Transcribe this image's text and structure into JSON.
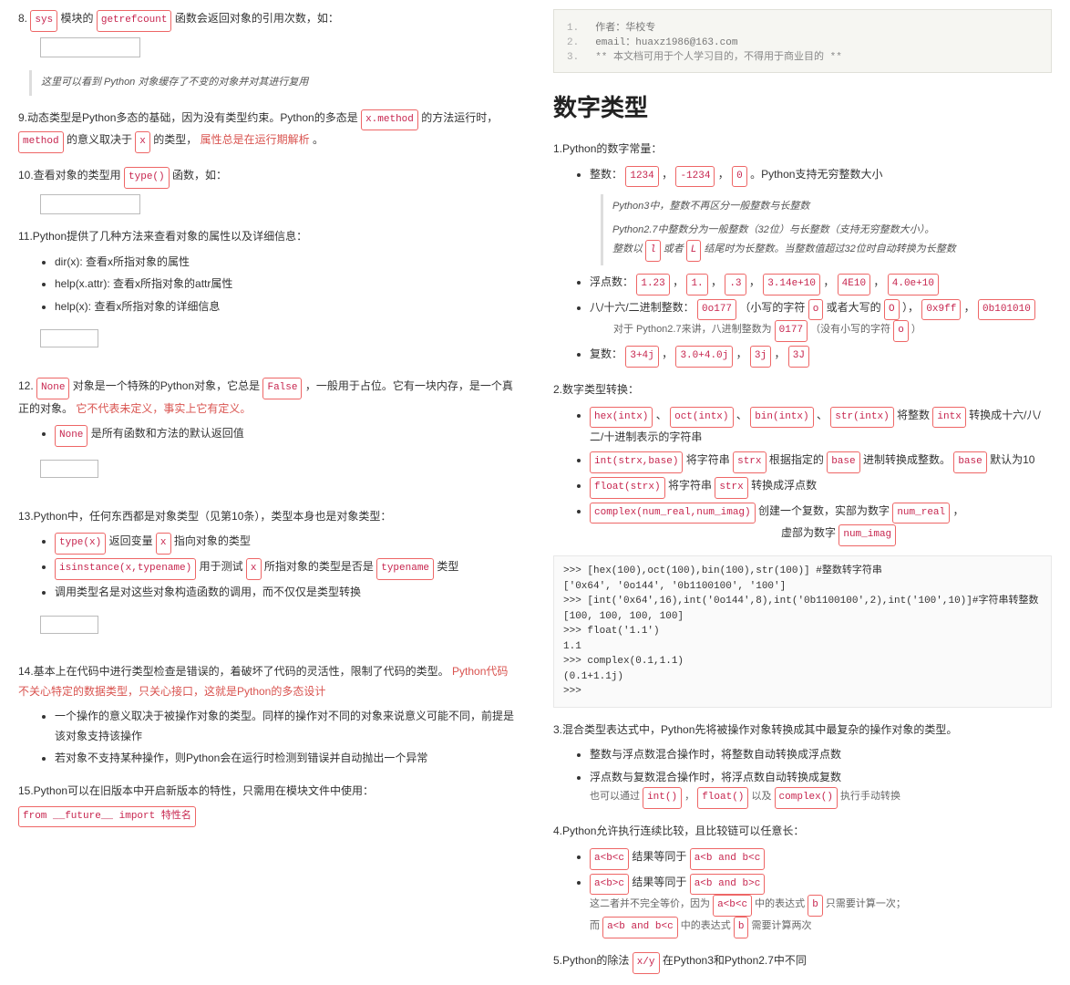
{
  "left": {
    "p8_a": "8.",
    "p8_sys": "sys",
    "p8_b": " 模块的 ",
    "p8_grc": "getrefcount",
    "p8_c": " 函数会返回对象的引用次数，如：",
    "p8_bq": "这里可以看到 Python 对象缓存了不变的对象并对其进行复用",
    "p9_a": "9.动态类型是Python多态的基础，因为没有类型约束。Python的多态是 ",
    "p9_xm": "x.method",
    "p9_b": " 的方法运行时，",
    "p9_m": "method",
    "p9_c": " 的意义取决于 ",
    "p9_x": "x",
    "p9_d": " 的类型，",
    "p9_red": "属性总是在运行期解析",
    "p9_e": "。",
    "p10_a": "10.查看对象的类型用 ",
    "p10_t": "type()",
    "p10_b": " 函数，如：",
    "p11_a": "11.Python提供了几种方法来查看对象的属性以及详细信息：",
    "p11_li1": "dir(x): 查看x所指对象的属性",
    "p11_li2": "help(x.attr): 查看x所指对象的attr属性",
    "p11_li3": "help(x): 查看x所指对象的详细信息",
    "p12_a": "12. ",
    "p12_none": "None",
    "p12_b": " 对象是一个特殊的Python对象，它总是 ",
    "p12_false": "False",
    "p12_c": " ，一般用于占位。它有一块内存，是一个真正的对象。",
    "p12_red": "它不代表未定义，事实上它有定义。",
    "p12_li_a": "",
    "p12_li_none": "None",
    "p12_li_b": " 是所有函数和方法的默认返回值",
    "p13_a": "13.Python中，任何东西都是对象类型（见第10条），类型本身也是对象类型：",
    "p13_li1_a": "",
    "p13_li1_t": "type(x)",
    "p13_li1_b": " 返回变量 ",
    "p13_li1_x": "x",
    "p13_li1_c": " 指向对象的类型",
    "p13_li2_a": "",
    "p13_li2_is": "isinstance(x,typename)",
    "p13_li2_b": " 用于测试 ",
    "p13_li2_x": "x",
    "p13_li2_c": " 所指对象的类型是否是 ",
    "p13_li2_tn": "typename",
    "p13_li2_d": " 类型",
    "p13_li3": "调用类型名是对这些对象构造函数的调用，而不仅仅是类型转换",
    "p14_a": "14.基本上在代码中进行类型检查是错误的，着破坏了代码的灵活性，限制了代码的类型。",
    "p14_red": "Python代码不关心特定的数据类型，只关心接口，这就是Python的多态设计",
    "p14_li1": "一个操作的意义取决于被操作对象的类型。同样的操作对不同的对象来说意义可能不同，前提是该对象支持该操作",
    "p14_li2": "若对象不支持某种操作，则Python会在运行时检测到错误并自动抛出一个异常",
    "p15_a": "15.Python可以在旧版本中开启新版本的特性，只需用在模块文件中使用：",
    "p15_code": "from __future__ import 特性名"
  },
  "right": {
    "hdr_l1": "作者：华校专",
    "hdr_l2": "email：huaxz1986@163.com",
    "hdr_l3": "**  本文档可用于个人学习目的，不得用于商业目的  **",
    "title": "数字类型",
    "s1": "1.Python的数字常量：",
    "s1_int_a": "整数：",
    "s1_int_c1": "1234",
    "s1_int_c2": "-1234",
    "s1_int_c3": "0",
    "s1_int_b": "。Python支持无穷整数大小",
    "s1_int_bq1": "Python3中，整数不再区分一般整数与长整数",
    "s1_int_bq2_a": "Python2.7中整数分为一般整数（32位）与长整数（支持无穷整数大小）。",
    "s1_int_bq2_b": "整数以 ",
    "s1_int_bq2_l": "l",
    "s1_int_bq2_c": " 或者 ",
    "s1_int_bq2_L": "L",
    "s1_int_bq2_d": " 结尾时为长整数。当整数值超过32位时自动转换为长整数",
    "s1_fl_a": "浮点数：",
    "s1_fl_c1": "1.23",
    "s1_fl_c2": "1.",
    "s1_fl_c3": ".3",
    "s1_fl_c4": "3.14e+10",
    "s1_fl_c5": "4E10",
    "s1_fl_c6": "4.0e+10",
    "s1_hex_a": "八/十六/二进制整数：",
    "s1_hex_c1": "0o177",
    "s1_hex_b": "（小写的字符 ",
    "s1_hex_o": "o",
    "s1_hex_c": " 或者大写的 ",
    "s1_hex_O": "O",
    "s1_hex_d": " ），",
    "s1_hex_c2": "0x9ff",
    "s1_hex_c3": "0b101010",
    "s1_hex_sub_a": "对于 Python2.7来讲，八进制整数为 ",
    "s1_hex_sub_c": "0177",
    "s1_hex_sub_b": " （没有小写的字符 ",
    "s1_hex_sub_o": "o",
    "s1_hex_sub_d": " ）",
    "s1_cx_a": "复数：",
    "s1_cx_c1": "3+4j",
    "s1_cx_c2": "3.0+4.0j",
    "s1_cx_c3": "3j",
    "s1_cx_c4": "3J",
    "s2": "2.数字类型转换：",
    "s2_li1_c1": "hex(intx)",
    "s2_li1_c2": "oct(intx)",
    "s2_li1_c3": "bin(intx)",
    "s2_li1_c4": "str(intx)",
    "s2_li1_a": "将整数 ",
    "s2_li1_ix": "intx",
    "s2_li1_b": " 转换成十六/八/二/十进制表示的字符串",
    "s2_li2_c1": "int(strx,base)",
    "s2_li2_a": " 将字符串 ",
    "s2_li2_sx": "strx",
    "s2_li2_b": " 根据指定的 ",
    "s2_li2_bs": "base",
    "s2_li2_c": " 进制转换成整数。",
    "s2_li2_bs2": "base",
    "s2_li2_d": " 默认为10",
    "s2_li3_c1": "float(strx)",
    "s2_li3_a": " 将字符串 ",
    "s2_li3_sx": "strx",
    "s2_li3_b": " 转换成浮点数",
    "s2_li4_c1": "complex(num_real,num_imag)",
    "s2_li4_a": " 创建一个复数，实部为数字 ",
    "s2_li4_nr": "num_real",
    "s2_li4_b": " ，",
    "s2_li4_cont_a": "虚部为数字 ",
    "s2_li4_ni": "num_imag",
    "pre": ">>> [hex(100),oct(100),bin(100),str(100)] #整数转字符串\n['0x64', '0o144', '0b1100100', '100']\n>>> [int('0x64',16),int('0o144',8),int('0b1100100',2),int('100',10)]#字符串转整数\n[100, 100, 100, 100]\n>>> float('1.1')\n1.1\n>>> complex(0.1,1.1)\n(0.1+1.1j)\n>>> ",
    "s3": "3.混合类型表达式中，Python先将被操作对象转换成其中最复杂的操作对象的类型。",
    "s3_li1": "整数与浮点数混合操作时，将整数自动转换成浮点数",
    "s3_li2": "浮点数与复数混合操作时，将浮点数自动转换成复数",
    "s3_sub_a": "也可以通过 ",
    "s3_sub_c1": "int()",
    "s3_sub_c2": "float()",
    "s3_sub_b": " 以及 ",
    "s3_sub_c3": "complex()",
    "s3_sub_c": " 执行手动转换",
    "s4": "4.Python允许执行连续比较，且比较链可以任意长：",
    "s4_li1_c": "a<b<c",
    "s4_li1_a": " 结果等同于 ",
    "s4_li1_c2": "a<b and b<c",
    "s4_li2_c": "a<b>c",
    "s4_li2_a": " 结果等同于 ",
    "s4_li2_c2": "a<b and b>c",
    "s4_sub1_a": "这二者并不完全等价，因为 ",
    "s4_sub1_c": "a<b<c",
    "s4_sub1_b": " 中的表达式 ",
    "s4_sub1_bb": "b",
    "s4_sub1_d": " 只需要计算一次；",
    "s4_sub2_a": "而 ",
    "s4_sub2_c": "a<b and b<c",
    "s4_sub2_b": " 中的表达式 ",
    "s4_sub2_bb": "b",
    "s4_sub2_d": " 需要计算两次",
    "s5_a": "5.Python的除法 ",
    "s5_c": "x/y",
    "s5_b": " 在Python3和Python2.7中不同"
  }
}
